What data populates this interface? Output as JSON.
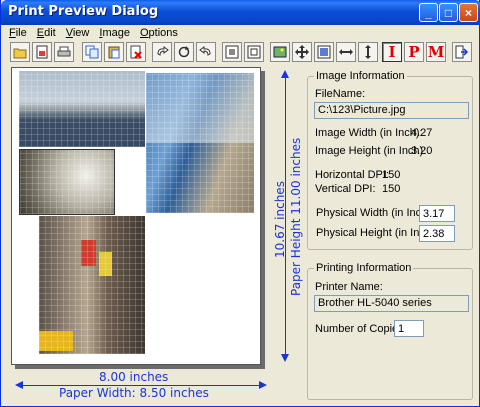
{
  "window": {
    "title": "Print Preview Dialog",
    "buttons": {
      "minimize": "_",
      "maximize": "□",
      "close": "×"
    }
  },
  "menu": [
    {
      "label": "File",
      "accel": "F"
    },
    {
      "label": "Edit",
      "accel": "E"
    },
    {
      "label": "View",
      "accel": "V"
    },
    {
      "label": "Image",
      "accel": "I"
    },
    {
      "label": "Options",
      "accel": "O"
    }
  ],
  "toolbar": {
    "buttons": [
      {
        "name": "open-icon"
      },
      {
        "name": "save-icon"
      },
      {
        "name": "print-icon"
      },
      {
        "name": "copy-icon"
      },
      {
        "name": "paste-icon"
      },
      {
        "name": "delete-icon"
      },
      {
        "name": "undo-icon"
      },
      {
        "name": "rotate-icon"
      },
      {
        "name": "redo-icon"
      },
      {
        "name": "fit-icon"
      },
      {
        "name": "actual-size-icon"
      },
      {
        "name": "image-icon"
      },
      {
        "name": "move-icon"
      },
      {
        "name": "page-icon"
      },
      {
        "name": "stretch-horizontal-icon"
      },
      {
        "name": "stretch-vertical-icon"
      }
    ],
    "text_buttons": [
      "I",
      "P",
      "M"
    ],
    "exit_icon": "exit-icon"
  },
  "paper": {
    "width_label": "8.00 inches",
    "paper_width_label": "Paper Width: 8.50 inches",
    "height_label": "10.67 inches",
    "paper_height_label": "Paper Height 11.00 inches"
  },
  "image_info": {
    "legend": "Image Information",
    "filename_label": "FileName:",
    "filename_value": "C:\\123\\Picture.jpg",
    "width_label": "Image Width (in Inch):",
    "width_value": "4.27",
    "height_label": "Image Height (in Inch):",
    "height_value": "3.20",
    "hdpi_label": "Horizontal DPI:",
    "hdpi_value": "150",
    "vdpi_label": "Vertical DPI:",
    "vdpi_value": "150",
    "phys_width_label": "Physical Width (in Inch):",
    "phys_width_value": "3.17",
    "phys_height_label": "Physical Height (in Inch):",
    "phys_height_value": "2.38"
  },
  "printing_info": {
    "legend": "Printing Information",
    "printer_label": "Printer Name:",
    "printer_value": "Brother HL-5040 series",
    "copies_label": "Number of Copies:",
    "copies_value": "1"
  }
}
